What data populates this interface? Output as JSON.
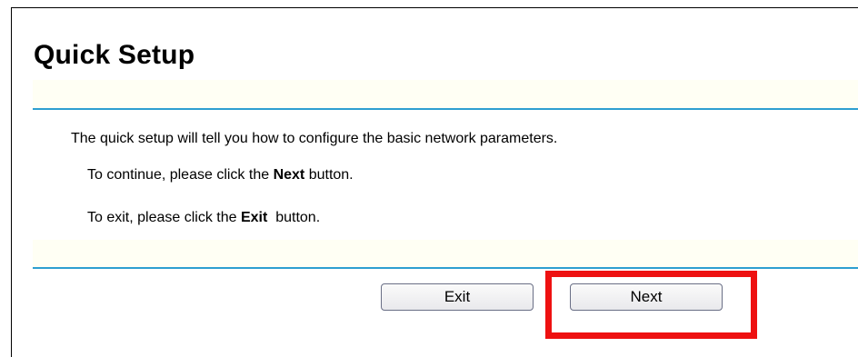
{
  "page": {
    "title": "Quick Setup"
  },
  "content": {
    "intro": "The quick setup will tell you how to configure the basic network parameters.",
    "continue_prefix": "To continue, please click the ",
    "continue_keyword": "Next",
    "continue_suffix": " button.",
    "exit_prefix": "To exit, please click the ",
    "exit_keyword": "Exit",
    "exit_suffix": "  button."
  },
  "buttons": {
    "exit_label": "Exit",
    "next_label": "Next"
  },
  "colors": {
    "accent_rule": "#2e9fd0",
    "band_background": "#fffff4",
    "highlight": "#ee1111"
  }
}
